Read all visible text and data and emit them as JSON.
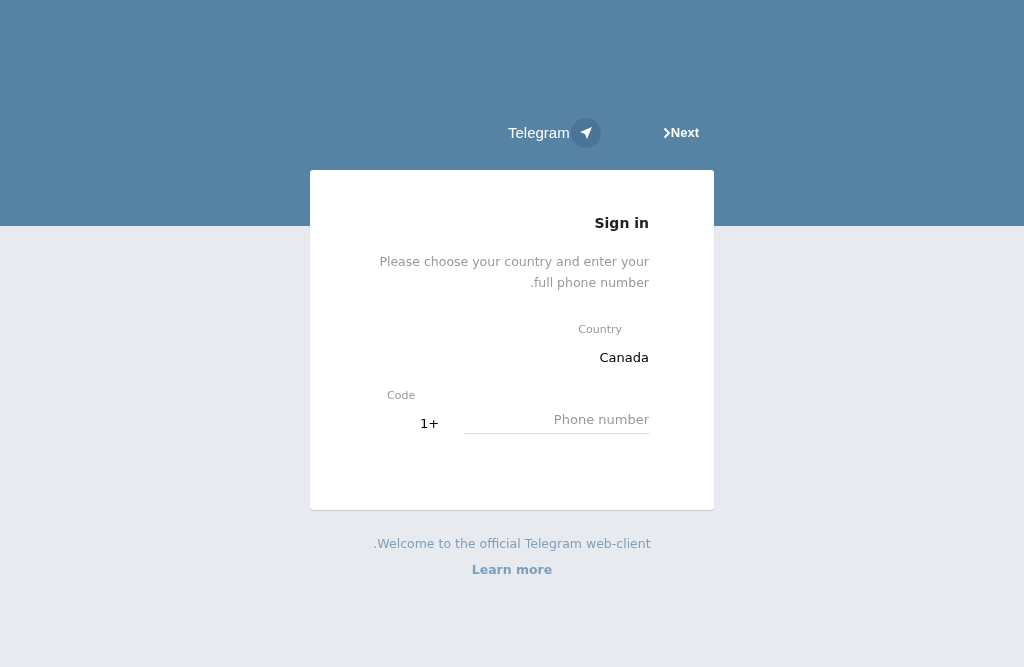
{
  "header": {
    "logo_text": "Telegram",
    "next_button": "Next"
  },
  "sign_in": {
    "title": "Sign in",
    "description": "Please choose your country and enter your full phone number.",
    "country": {
      "label": "Country",
      "value": "Canada"
    },
    "code": {
      "label": "Code",
      "value": "+1"
    },
    "phone": {
      "placeholder": "Phone number"
    }
  },
  "footer": {
    "welcome": "Welcome to the official Telegram web-client.",
    "learn_more": "Learn more"
  }
}
